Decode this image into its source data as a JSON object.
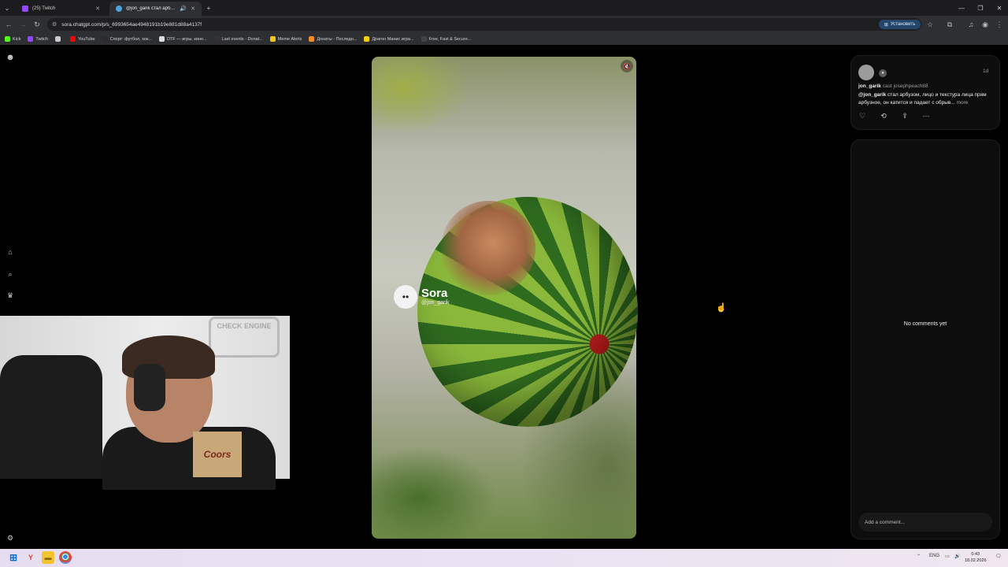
{
  "browser": {
    "tabs": [
      {
        "title": "(25) Twitch",
        "active": false
      },
      {
        "title": "@jon_garik стал арбузом, ...",
        "active": true
      }
    ],
    "new_tab": "+",
    "url": "sora.chatgpt.com/p/s_6993654ae4948191b19e881d88a4137f",
    "install_label": "Установить",
    "bookmarks": [
      {
        "label": "Kick",
        "color": "#53fc18"
      },
      {
        "label": "Twitch",
        "color": "#9146ff"
      },
      {
        "label": "",
        "color": "#cccccc"
      },
      {
        "label": "YouTube",
        "color": "#ff0000"
      },
      {
        "label": "Спорт: футбол, хок...",
        "color": "#2b2b2b"
      },
      {
        "label": "DTF — игры, кино...",
        "color": "#dddddd"
      },
      {
        "label": "Last events - Donat...",
        "color": "#333333"
      },
      {
        "label": "Meme Alerts",
        "color": "#f5c518"
      },
      {
        "label": "Донаты - Последн...",
        "color": "#f28c28"
      },
      {
        "label": "Драгон Манис игра...",
        "color": "#f5d000"
      },
      {
        "label": "Free, Fast & Secure...",
        "color": "#444444"
      }
    ]
  },
  "video": {
    "watermark_name": "Sora",
    "watermark_handle": "@jon_garik",
    "webcam_sign": "CHECK ENGINE",
    "box_text": "Coors"
  },
  "post": {
    "username": "jon_garik",
    "cast_text": "cast josephpeach88",
    "time": "1d",
    "mention": "@jon_garik",
    "caption": " стал арбузом, лицо и текстура лица прям арбузное, он катится и падает с обрыв...",
    "more": "more"
  },
  "comments": {
    "empty_text": "No comments yet",
    "input_placeholder": "Add a comment..."
  },
  "taskbar": {
    "tray_lang": "ENG",
    "time": "0:43",
    "date": "18.02.2026"
  },
  "icons": {
    "sidebar": [
      "home-icon",
      "search-icon",
      "trophy-icon",
      "settings-icon"
    ],
    "actions": [
      "heart-icon",
      "remix-icon",
      "share-icon",
      "more-icon"
    ]
  },
  "colors": {
    "page_bg": "#000000",
    "panel_bg": "#0d0d0d",
    "install_button": "#24466b",
    "watermelon_dark": "#2f6b1f",
    "watermelon_light": "#89b83a"
  }
}
